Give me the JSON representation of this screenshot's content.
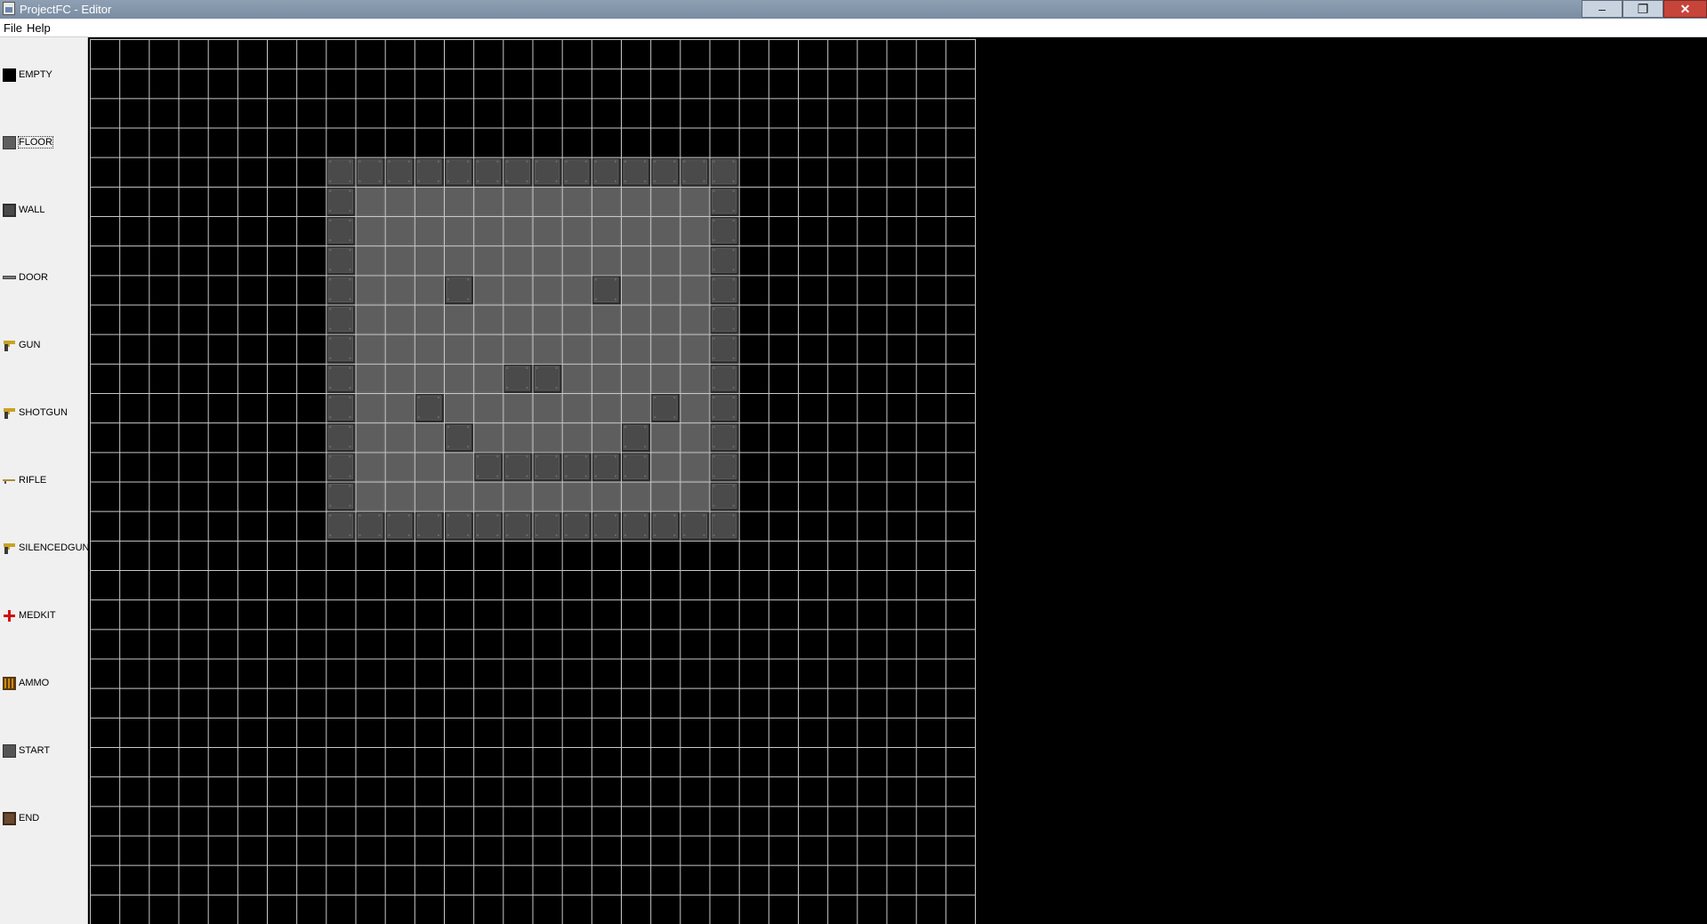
{
  "window": {
    "title": "ProjectFC - Editor",
    "controls": {
      "minimize": "–",
      "maximize": "❐",
      "close": "✕"
    }
  },
  "menubar": {
    "items": [
      "File",
      "Help"
    ]
  },
  "palette": {
    "selected": "FLOOR",
    "items": [
      {
        "label": "EMPTY",
        "icon": "empty-tile-icon",
        "color": "#000000"
      },
      {
        "label": "FLOOR",
        "icon": "floor-tile-icon",
        "color": "#5e5e5e"
      },
      {
        "label": "WALL",
        "icon": "wall-tile-icon",
        "color": "#4a4a4a"
      },
      {
        "label": "DOOR",
        "icon": "door-icon",
        "color": "#7a7a7a"
      },
      {
        "label": "GUN",
        "icon": "gun-icon",
        "color": "#c9a227"
      },
      {
        "label": "SHOTGUN",
        "icon": "shotgun-icon",
        "color": "#c9a227"
      },
      {
        "label": "RIFLE",
        "icon": "rifle-icon",
        "color": "#b08a3a"
      },
      {
        "label": "SILENCEDGUN",
        "icon": "silenced-gun-icon",
        "color": "#c9a227"
      },
      {
        "label": "MEDKIT",
        "icon": "medkit-icon",
        "color": "#d01010"
      },
      {
        "label": "AMMO",
        "icon": "ammo-icon",
        "color": "#d08a10"
      },
      {
        "label": "START",
        "icon": "start-tile-icon",
        "color": "#555555"
      },
      {
        "label": "END",
        "icon": "end-tile-icon",
        "color": "#6a4a30"
      }
    ]
  },
  "map": {
    "cols": 30,
    "rows": 30,
    "grid_color": "#c8c8c8",
    "empty_color": "#000000",
    "floor_color": "#5e5e5e",
    "wall_color": "#4a4a4a",
    "tiles": [
      "..............................",
      "..............................",
      "..............................",
      "..............................",
      "........WWWWWWWWWWWWWW........",
      "........WFFFFFFFFFFFFW........",
      "........WFFFFFFFFFFFFW........",
      "........WFFFFFFFFFFFFW........",
      "........WFFFWFFFFWFFFW........",
      "........WFFFFFFFFFFFFW........",
      "........WFFFFFFFFFFFFW........",
      "........WFFFFFWWFFFFFW........",
      "........WFFWFFFFFFFWFW........",
      "........WFFFWFFFFFWFFW........",
      "........WFFFFWWWWWWFFW........",
      "........WFFFFFFFFFFFFW........",
      "........WWWWWWWWWWWWWW........",
      "..............................",
      "..............................",
      "..............................",
      "..............................",
      "..............................",
      "..............................",
      "..............................",
      "..............................",
      "..............................",
      "..............................",
      "..............................",
      "..............................",
      ".............................."
    ]
  }
}
